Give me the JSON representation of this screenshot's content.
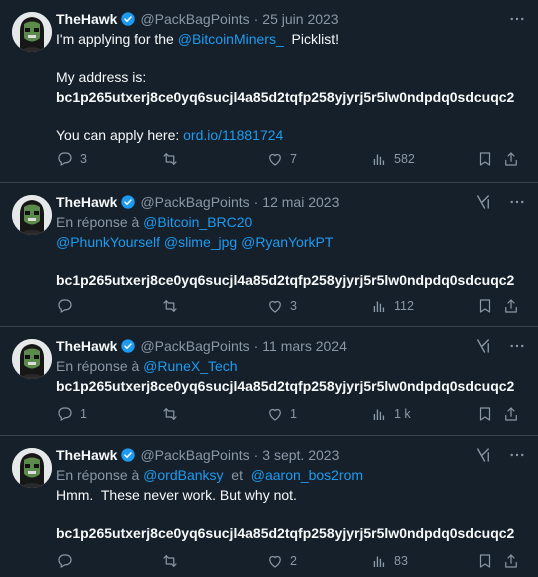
{
  "tweets": [
    {
      "name": "TheHawk",
      "handle": "@PackBagPoints",
      "date": "25 juin 2023",
      "line1_prefix": "I'm applying for the ",
      "line1_mention": "@BitcoinMiners_",
      "line1_suffix": "  Picklist!",
      "line2": "My address is:",
      "address": "bc1p265utxerj8ce0yq6sucjl4a85d2tqfp258yjyrj5r5lw0ndpdq0sdcuqc2",
      "line3_prefix": "You can apply here: ",
      "line3_link": "ord.io/11881724",
      "replies": "3",
      "retweets": "",
      "likes": "7",
      "views": "582"
    },
    {
      "name": "TheHawk",
      "handle": "@PackBagPoints",
      "date": "12 mai 2023",
      "reply_prefix": "En réponse à ",
      "reply_to": "@Bitcoin_BRC20",
      "reply_more": "@PhunkYourself @slime_jpg @RyanYorkPT",
      "address": "bc1p265utxerj8ce0yq6sucjl4a85d2tqfp258yjyrj5r5lw0ndpdq0sdcuqc2",
      "replies": "",
      "retweets": "",
      "likes": "3",
      "views": "112"
    },
    {
      "name": "TheHawk",
      "handle": "@PackBagPoints",
      "date": "11 mars 2024",
      "reply_prefix": "En réponse à ",
      "reply_to": "@RuneX_Tech",
      "address": "bc1p265utxerj8ce0yq6sucjl4a85d2tqfp258yjyrj5r5lw0ndpdq0sdcuqc2",
      "replies": "1",
      "retweets": "",
      "likes": "1",
      "views": "1 k"
    },
    {
      "name": "TheHawk",
      "handle": "@PackBagPoints",
      "date": "3 sept. 2023",
      "reply_prefix": "En réponse à ",
      "reply_to": "@ordBanksy",
      "reply_and": "  et  ",
      "reply_to2": "@aaron_bos2rom",
      "line1": "Hmm.  These never work. But why not.",
      "address": "bc1p265utxerj8ce0yq6sucjl4a85d2tqfp258yjyrj5r5lw0ndpdq0sdcuqc2",
      "replies": "",
      "retweets": "",
      "likes": "2",
      "views": "83"
    }
  ],
  "icons": {
    "verified": "verified-badge-icon",
    "more": "more-icon",
    "grok": "grok-icon",
    "reply": "reply-icon",
    "retweet": "retweet-icon",
    "like": "like-icon",
    "views": "views-icon",
    "bookmark": "bookmark-icon",
    "share": "share-icon"
  },
  "colors": {
    "background": "#15202b",
    "text": "#f7f9f9",
    "muted": "#8b98a5",
    "link": "#1d9bf0",
    "border": "#38444d"
  }
}
